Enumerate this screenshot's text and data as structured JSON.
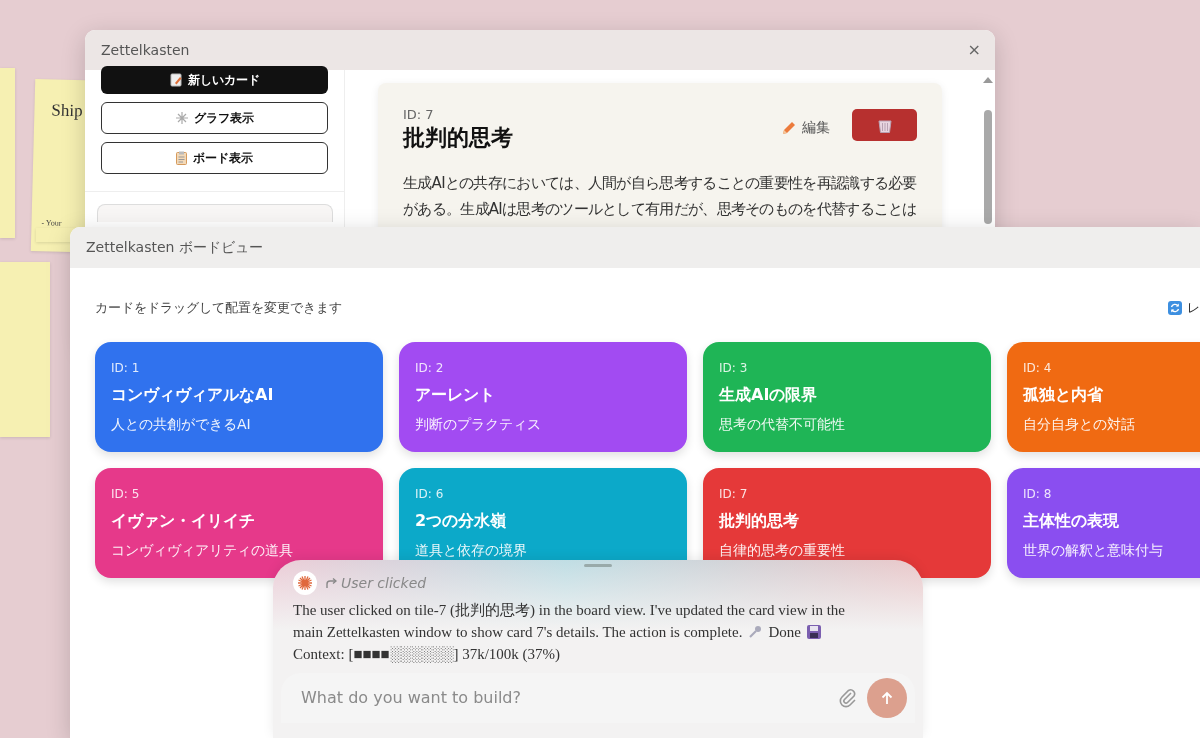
{
  "desktop_notes": [
    {
      "heading": "Ship",
      "signature": "- Your"
    }
  ],
  "main_window": {
    "title": "Zettelkasten",
    "close": "×",
    "sidebar_buttons": [
      {
        "label": "新しいカード",
        "kind": "primary"
      },
      {
        "label": "グラフ表示",
        "kind": "outline"
      },
      {
        "label": "ボード表示",
        "kind": "outline"
      }
    ],
    "search": {
      "kind": "field"
    },
    "card": {
      "id": "ID: 7",
      "title": "批判的思考",
      "edit": "編集",
      "body": "生成AIとの共存においては、人間が自ら思考することの重要性を再認識する必要がある。生成AIは思考のツールとして有用だが、思考そのものを代替することは"
    }
  },
  "board_window": {
    "title": "Zettelkasten ボードビュー",
    "hint": "カードをドラッグして配置を変更できます",
    "reset_button": "レ",
    "tiles": [
      {
        "id": "ID: 1",
        "title": "コンヴィヴィアルなAI",
        "subtitle": "人との共創ができるAI",
        "color": "#3072ee"
      },
      {
        "id": "ID: 2",
        "title": "アーレント",
        "subtitle": "判断のプラクティス",
        "color": "#a24bf2"
      },
      {
        "id": "ID: 3",
        "title": "生成AIの限界",
        "subtitle": "思考の代替不可能性",
        "color": "#1fb556"
      },
      {
        "id": "ID: 4",
        "title": "孤独と内省",
        "subtitle": "自分自身との対話",
        "color": "#f06a12"
      },
      {
        "id": "ID: 5",
        "title": "イヴァン・イリイチ",
        "subtitle": "コンヴィヴィアリティの道具",
        "color": "#e6398a"
      },
      {
        "id": "ID: 6",
        "title": "2つの分水嶺",
        "subtitle": "道具と依存の境界",
        "color": "#0ca9c9"
      },
      {
        "id": "ID: 7",
        "title": "批判的思考",
        "subtitle": "自律的思考の重要性",
        "color": "#e53939"
      },
      {
        "id": "ID: 8",
        "title": "主体性の表現",
        "subtitle": "世界の解釈と意味付与",
        "color": "#8a4ef0"
      }
    ]
  },
  "assistant": {
    "event": "User clicked",
    "message_lines": [
      "The user clicked on tile-7 (批判的思考) in the board view. I've updated the card view in the",
      "main Zettelkasten window to show card 7's details. The action is complete."
    ],
    "status": "Done",
    "context": "Context: [■■■■░░░░░░] 37k/100k (37%)",
    "input": {
      "placeholder": "What do you want to build?"
    }
  }
}
